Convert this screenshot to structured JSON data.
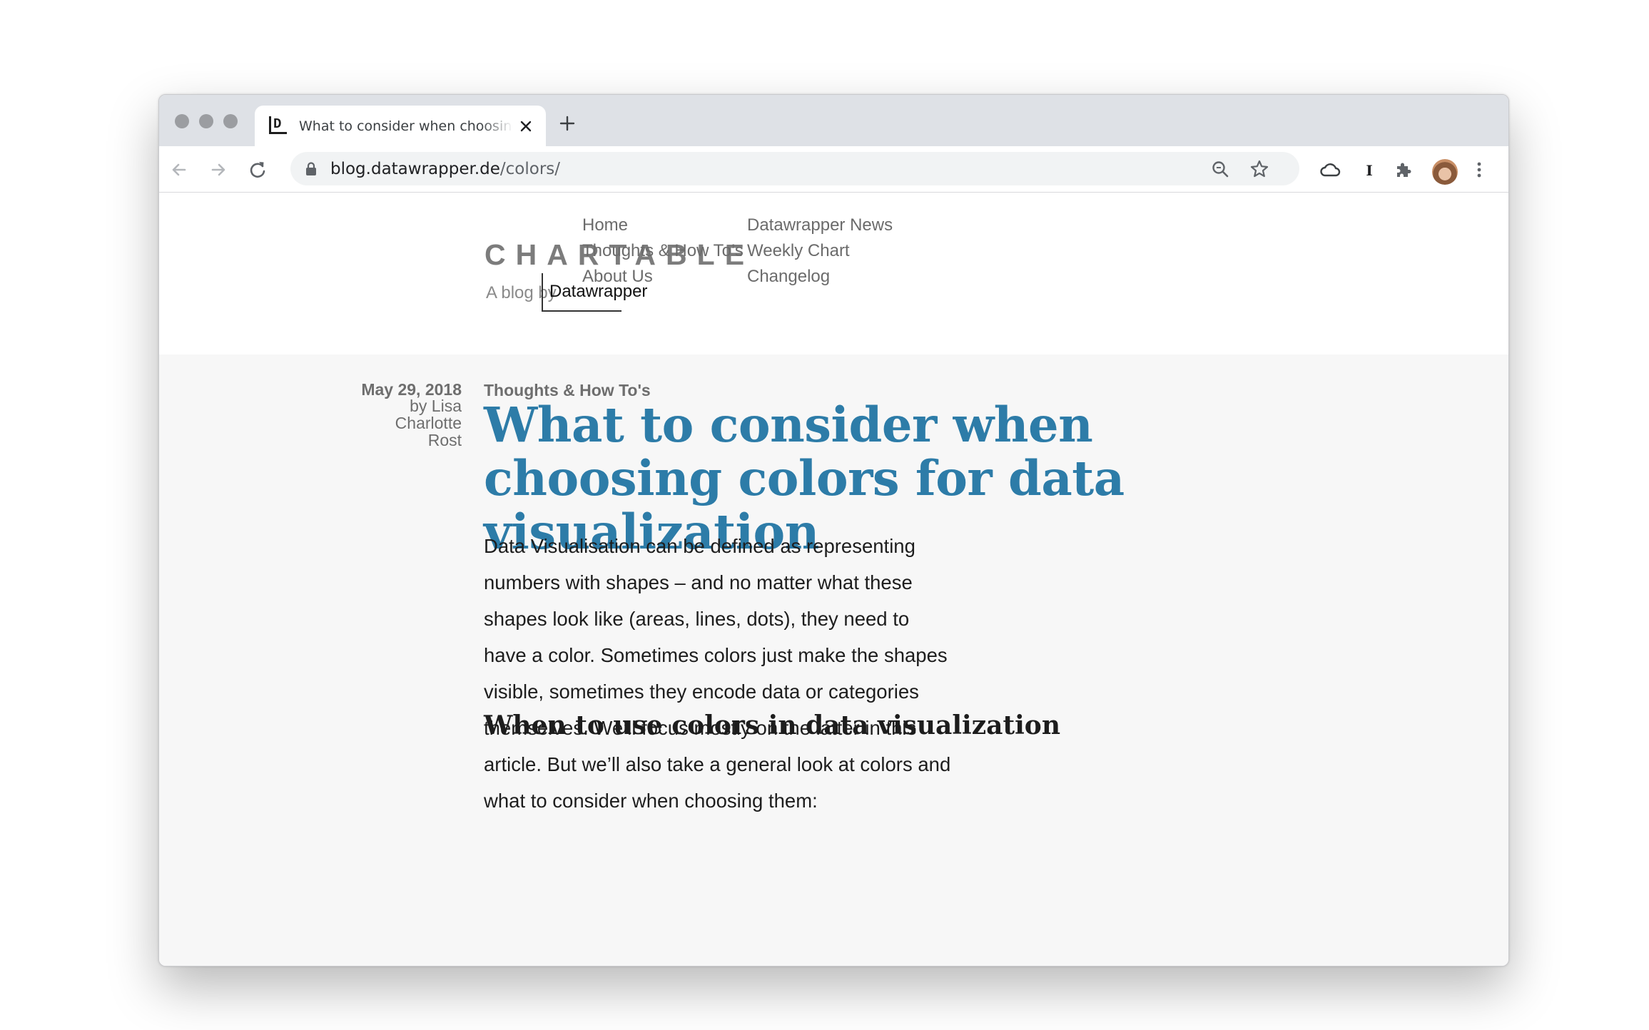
{
  "browser": {
    "tab": {
      "title": "What to consider when choosing colors for data visualization",
      "favicon_text": "D"
    },
    "url": {
      "host": "blog.datawrapper.de",
      "path": "/colors/"
    },
    "icons": {
      "back": "arrow-left-icon",
      "forward": "arrow-right-icon",
      "reload": "reload-icon",
      "lock": "lock-icon",
      "zoom": "magnifier-icon",
      "bookmark": "star-icon",
      "extension_cloud": "cloud-icon",
      "extension_i": "instapaper-icon",
      "extensions": "puzzle-icon",
      "menu": "kebab-menu-icon"
    }
  },
  "site": {
    "logo": "CHARTABLE",
    "tagline_prefix": "A blog by",
    "tagline_brand": "Datawrapper",
    "nav": {
      "home": "Home",
      "thoughts": "Thoughts & How To’s",
      "about": "About Us",
      "news": "Datawrapper News",
      "weekly": "Weekly Chart",
      "changelog": "Changelog"
    }
  },
  "article": {
    "date": "May 29, 2018",
    "author": "by Lisa Charlotte Rost",
    "category": "Thoughts & How To's",
    "title": "What to consider when choosing colors for data visualization",
    "intro": "Data Visualisation can be defined as representing numbers with shapes – and no matter what these shapes look like (areas, lines, dots), they need to have a color. Sometimes colors just make the shapes visible, sometimes they encode data or categories themselves. We’ll focus mostly on the latter in this article. But we’ll also take a general look at colors and what to consider when choosing them:",
    "subheading": "When to use colors in data visualization"
  },
  "colors": {
    "headline": "#2d7ca8",
    "page_background": "#f7f7f7",
    "tabstrip": "#dee1e6"
  }
}
